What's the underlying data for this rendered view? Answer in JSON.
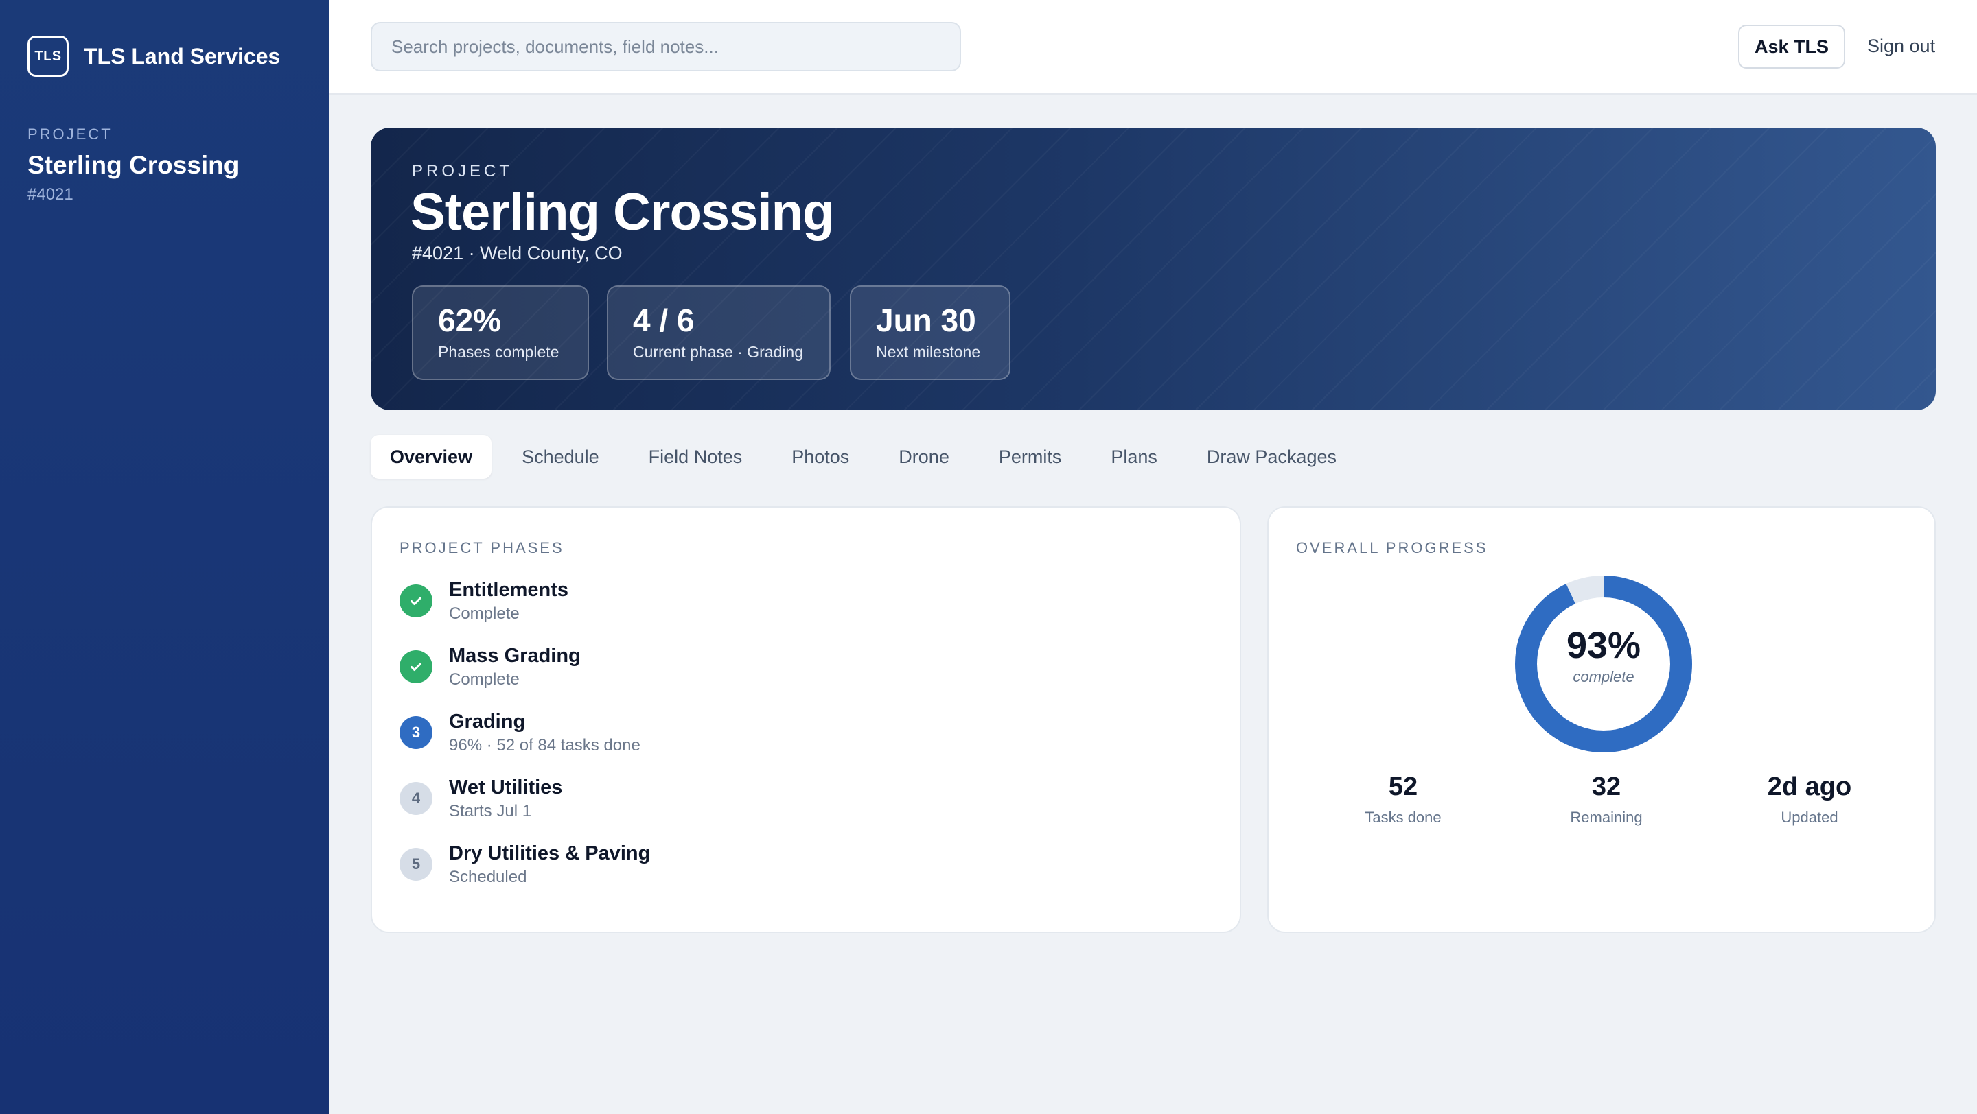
{
  "brand": {
    "logo_text": "TLS",
    "name": "TLS Land Services"
  },
  "sidebar": {
    "section_label": "PROJECT",
    "project_name": "Sterling Crossing",
    "project_number": "#4021"
  },
  "topbar": {
    "search_placeholder": "Search projects, documents, field notes...",
    "ask_label": "Ask TLS",
    "signout_label": "Sign out"
  },
  "hero": {
    "label": "PROJECT",
    "title": "Sterling Crossing",
    "subtitle": "#4021 · Weld County, CO",
    "stats": [
      {
        "value": "62%",
        "label": "Phases complete"
      },
      {
        "value": "4 / 6",
        "label": "Current phase · Grading"
      },
      {
        "value": "Jun 30",
        "label": "Next milestone"
      }
    ]
  },
  "tabs": [
    "Overview",
    "Schedule",
    "Field Notes",
    "Photos",
    "Drone",
    "Permits",
    "Plans",
    "Draw Packages"
  ],
  "active_tab": "Overview",
  "phases": {
    "title": "PROJECT PHASES",
    "items": [
      {
        "marker": "check-icon",
        "name": "Entitlements",
        "status": "Complete",
        "state": "done"
      },
      {
        "marker": "check-icon",
        "name": "Mass Grading",
        "status": "Complete",
        "state": "done"
      },
      {
        "marker": "3",
        "name": "Grading",
        "status": "96% · 52 of 84 tasks done",
        "state": "current"
      },
      {
        "marker": "4",
        "name": "Wet Utilities",
        "status": "Starts Jul 1",
        "state": "pending"
      },
      {
        "marker": "5",
        "name": "Dry Utilities & Paving",
        "status": "Scheduled",
        "state": "pending"
      }
    ]
  },
  "progress": {
    "title": "OVERALL PROGRESS",
    "percent_text": "93%",
    "percent_value": 0.93,
    "sub": "complete",
    "metrics": [
      {
        "value": "52",
        "label": "Tasks done"
      },
      {
        "value": "32",
        "label": "Remaining"
      },
      {
        "value": "2d ago",
        "label": "Updated"
      }
    ]
  },
  "colors": {
    "sidebar": "#1b3a78",
    "accent": "#2f6cc2",
    "success": "#2fae6a",
    "pending": "#d6dde7",
    "track": "#e2e8f0"
  }
}
